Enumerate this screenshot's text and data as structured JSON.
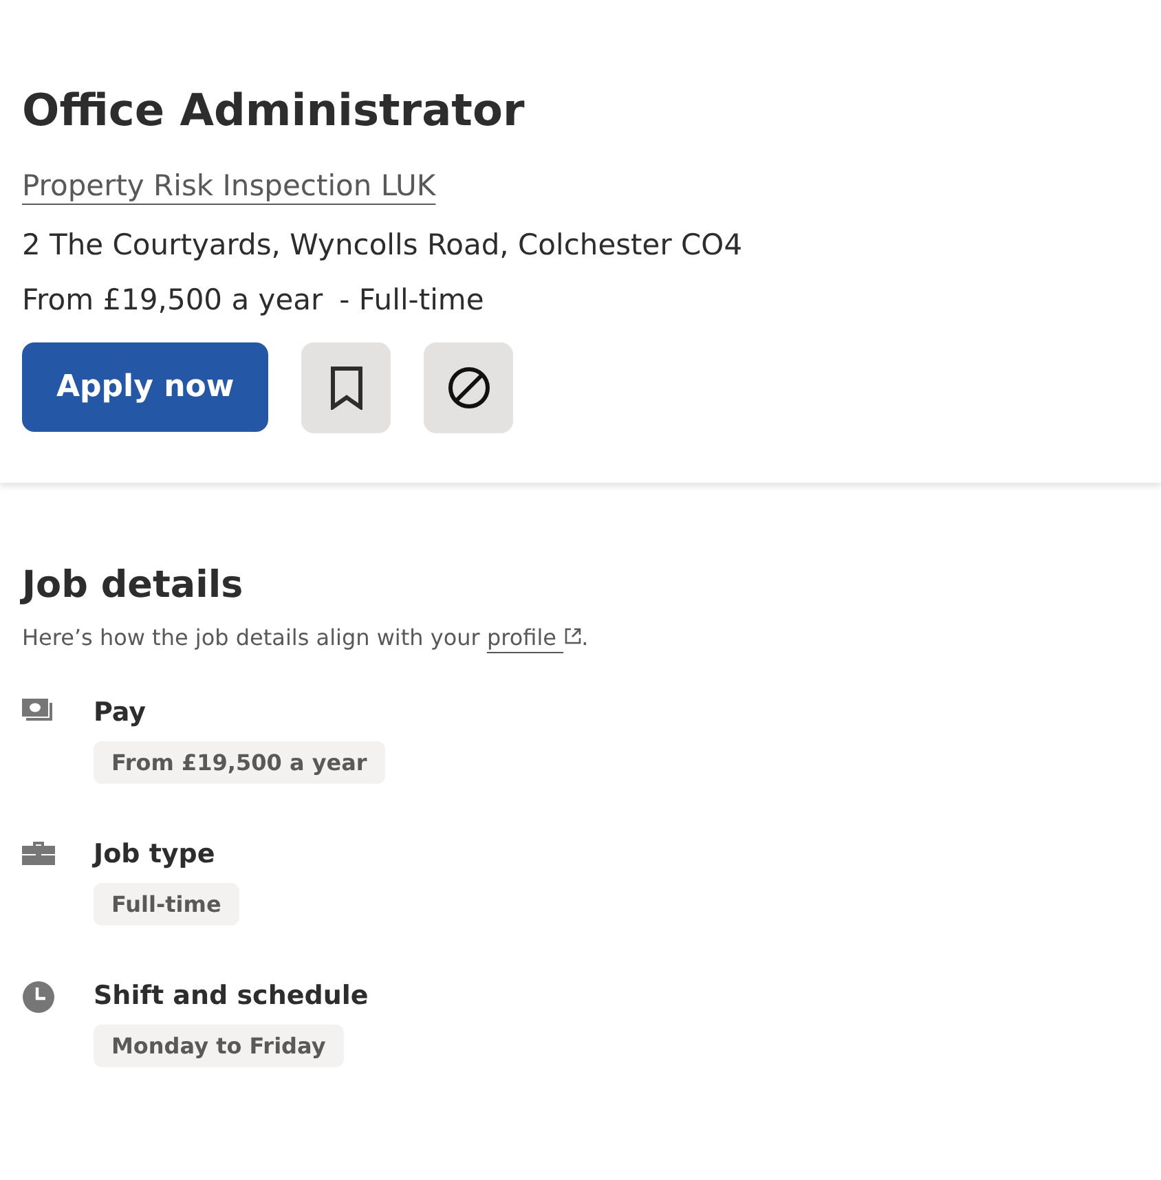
{
  "job": {
    "title": "Office Administrator",
    "company": "Property Risk Inspection LUK",
    "location": "2 The Courtyards, Wyncolls Road, Colchester CO4",
    "salary": "From £19,500 a year",
    "job_type": "- Full-time",
    "apply_label": "Apply now",
    "saved": false
  },
  "details": {
    "heading": "Job details",
    "intro": "Here’s how the job details align with your",
    "link": "profile",
    "after": ".",
    "items": [
      {
        "kind": "pay",
        "label": "Pay",
        "tags": [
          "From £19,500 a year"
        ]
      },
      {
        "kind": "job_type",
        "label": "Job type",
        "tags": [
          "Full-time"
        ]
      },
      {
        "kind": "schedule",
        "label": "Shift and schedule",
        "tags": [
          "Monday to Friday"
        ]
      }
    ]
  }
}
